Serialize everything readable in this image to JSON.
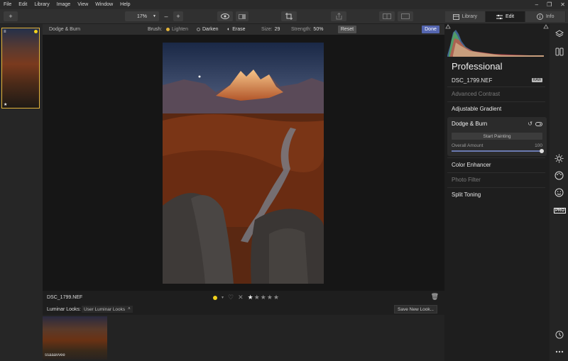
{
  "menu": [
    "File",
    "Edit",
    "Library",
    "Image",
    "View",
    "Window",
    "Help"
  ],
  "window_controls": {
    "minimize": "–",
    "restore": "❐",
    "close": "✕"
  },
  "toolbar": {
    "add_label": "+",
    "zoom_value": "17%",
    "zoom_out": "–",
    "zoom_in": "+"
  },
  "panel_tabs": {
    "library": "Library",
    "edit": "Edit",
    "info": "Info"
  },
  "dodge_burn_bar": {
    "title": "Dodge & Burn",
    "brush_label": "Brush:",
    "lighten": "Lighten",
    "darken": "Darken",
    "erase": "Erase",
    "size_label": "Size:",
    "size_value": "29",
    "strength_label": "Strength:",
    "strength_value": "50%",
    "reset": "Reset",
    "done": "Done"
  },
  "image_info": {
    "filename": "DSC_1799.NEF",
    "color_label": "yellow",
    "rating": 1,
    "max_rating": 5
  },
  "looks": {
    "label": "Luminar Looks:",
    "selected": "User Luminar Looks",
    "save_button": "Save New Look...",
    "items": [
      {
        "name": "ssaaavvee"
      }
    ]
  },
  "right_panel": {
    "workspace_title": "Professional",
    "filename": "DSC_1799.NEF",
    "raw_badge": "RAW",
    "filters": [
      {
        "name": "Advanced Contrast",
        "state": "dim"
      },
      {
        "name": "Adjustable Gradient",
        "state": "bright"
      },
      {
        "name": "Color Enhancer",
        "state": "bright"
      },
      {
        "name": "Photo Filter",
        "state": "dim"
      },
      {
        "name": "Split Toning",
        "state": "bright"
      }
    ],
    "active_filter": {
      "name": "Dodge & Burn",
      "start_button": "Start Painting",
      "amount_label": "Overall Amount",
      "amount_value": "100"
    }
  },
  "rail": {
    "pro_label": "PRO"
  },
  "colors": {
    "accent": "#5566b0",
    "selection": "#e4b43a",
    "color_label_yellow": "#f2d21c"
  }
}
